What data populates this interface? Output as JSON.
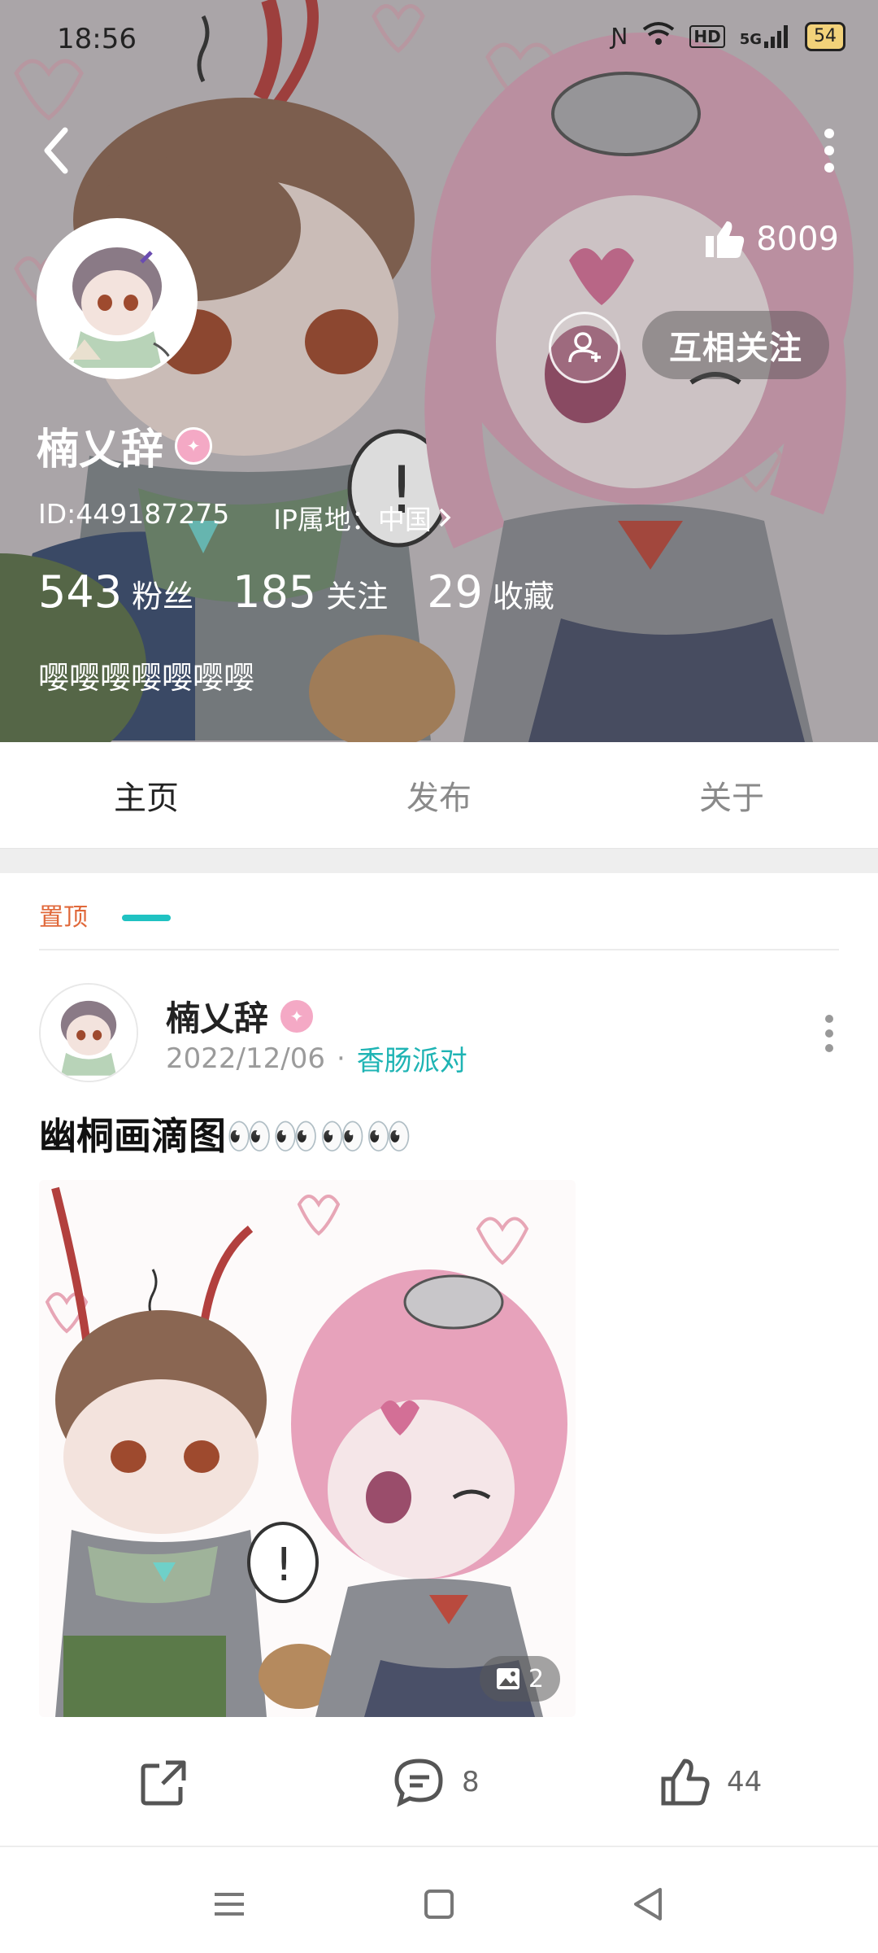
{
  "status_bar": {
    "time": "18:56",
    "network": "5G",
    "hd": "HD",
    "battery": "54"
  },
  "profile": {
    "likes": "8009",
    "follow_label": "互相关注",
    "username": "楠乂辞",
    "id": "ID:449187275",
    "ip_location": "IP属地：中国",
    "stats": [
      {
        "value": "543",
        "label": "粉丝"
      },
      {
        "value": "185",
        "label": "关注"
      },
      {
        "value": "29",
        "label": "收藏"
      }
    ],
    "bio": "嘤嘤嘤嘤嘤嘤嘤"
  },
  "tabs": [
    {
      "label": "主页",
      "active": true
    },
    {
      "label": "发布",
      "active": false
    },
    {
      "label": "关于",
      "active": false
    }
  ],
  "post": {
    "pinned_label": "置顶",
    "author": "楠乂辞",
    "date": "2022/12/06",
    "topic": "香肠派对",
    "title": "幽桐画滴图👀👀👀👀",
    "image_count": "2",
    "comments": "8",
    "likes": "44"
  },
  "colors": {
    "accent": "#20c2c2",
    "pinned": "#e0683a",
    "topic": "#1fb4b4"
  }
}
